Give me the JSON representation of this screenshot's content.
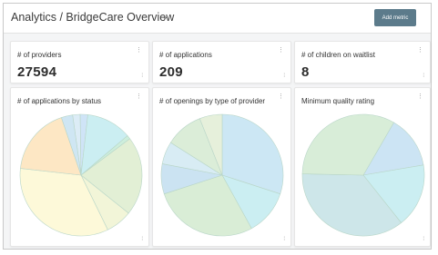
{
  "header": {
    "title": "Analytics / BridgeCare Overview",
    "chevron_icon": "chevron-down-icon",
    "add_metric_label": "Add metric"
  },
  "metrics": [
    {
      "label": "# of providers",
      "value": "27594"
    },
    {
      "label": "# of applications",
      "value": "209"
    },
    {
      "label": "# of children on waitlist",
      "value": "8"
    }
  ],
  "charts": [
    {
      "label": "# of applications by status"
    },
    {
      "label": "# of openings by type of provider"
    },
    {
      "label": "Minimum quality rating"
    }
  ],
  "chart_data": [
    {
      "type": "pie",
      "title": "# of applications by status",
      "values": [
        2,
        2,
        12,
        1,
        21,
        7,
        34,
        18,
        3
      ],
      "colors": [
        "#dcecf6",
        "#cfe4f7",
        "#cbeef2",
        "#cdeedc",
        "#e2efd5",
        "#f2f5d8",
        "#fdf9d9",
        "#fde7c4",
        "#cfe6f3"
      ]
    },
    {
      "type": "pie",
      "title": "# of openings by type of provider",
      "values": [
        30,
        12,
        28,
        8,
        6,
        10,
        6
      ],
      "colors": [
        "#cce7f4",
        "#cbeef2",
        "#d9edd6",
        "#cbe3f2",
        "#d8ecf4",
        "#dbedd8",
        "#e6f0db"
      ]
    },
    {
      "type": "pie",
      "title": "Minimum quality rating",
      "values": [
        14,
        17,
        36,
        33
      ],
      "colors": [
        "#cce4f4",
        "#cbeef2",
        "#cde6e9",
        "#d8edd8"
      ]
    }
  ]
}
